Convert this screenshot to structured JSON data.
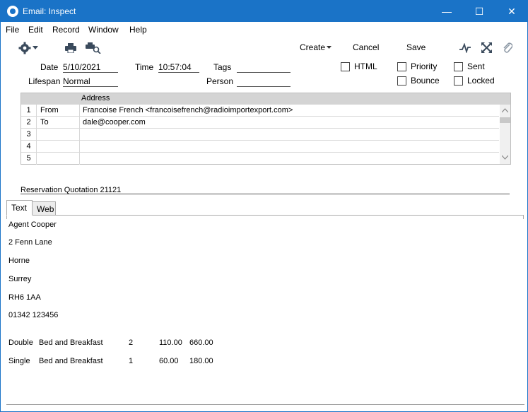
{
  "window": {
    "title": "Email: Inspect",
    "minimize": "—",
    "maximize": "☐",
    "close": "✕"
  },
  "menu": {
    "file": "File",
    "edit": "Edit",
    "record": "Record",
    "window": "Window",
    "help": "Help"
  },
  "toolbar": {
    "create": "Create",
    "cancel": "Cancel",
    "save": "Save"
  },
  "header": {
    "date_label": "Date",
    "date_value": "5/10/2021",
    "time_label": "Time",
    "time_value": "10:57:04",
    "tags_label": "Tags",
    "tags_value": "",
    "lifespan_label": "Lifespan",
    "lifespan_value": "Normal",
    "person_label": "Person",
    "person_value": ""
  },
  "flags": {
    "html": "HTML",
    "priority": "Priority",
    "sent": "Sent",
    "bounce": "Bounce",
    "locked": "Locked"
  },
  "grid": {
    "column_address": "Address",
    "rows": [
      {
        "num": "1",
        "type": "From",
        "address": "Francoise French <francoisefrench@radioimportexport.com>"
      },
      {
        "num": "2",
        "type": "To",
        "address": "dale@cooper.com"
      },
      {
        "num": "3",
        "type": "",
        "address": ""
      },
      {
        "num": "4",
        "type": "",
        "address": ""
      },
      {
        "num": "5",
        "type": "",
        "address": ""
      }
    ]
  },
  "subject": "Reservation Quotation 21121",
  "tabs": {
    "text": "Text",
    "web": "Web"
  },
  "body": {
    "lines": [
      "Agent Cooper",
      "2 Fenn Lane",
      "Horne",
      "Surrey",
      "RH6 1AA",
      "01342 123456"
    ],
    "items": [
      {
        "room": "Double",
        "board": "Bed and Breakfast",
        "qty": "2",
        "price": "110.00",
        "total": "660.00"
      },
      {
        "room": "Single",
        "board": "Bed and Breakfast",
        "qty": "1",
        "price": "60.00",
        "total": "180.00"
      }
    ]
  },
  "icons": [
    "gear-icon",
    "print-icon",
    "print-preview-icon",
    "pulse-icon",
    "expand-icon",
    "attachment-icon"
  ]
}
